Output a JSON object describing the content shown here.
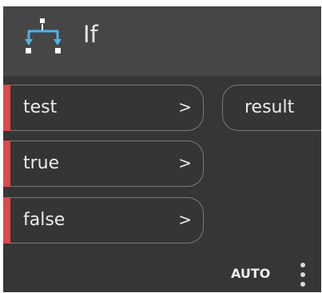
{
  "node": {
    "title": "If",
    "icon": "branch-icon",
    "accent_color": "#e0484c",
    "inputs": [
      {
        "label": "test",
        "arrow": ">"
      },
      {
        "label": "true",
        "arrow": ">"
      },
      {
        "label": "false",
        "arrow": ">"
      }
    ],
    "outputs": [
      {
        "label": "result"
      }
    ],
    "lacing": "AUTO",
    "menu_icon": "vertical-ellipsis-icon"
  }
}
